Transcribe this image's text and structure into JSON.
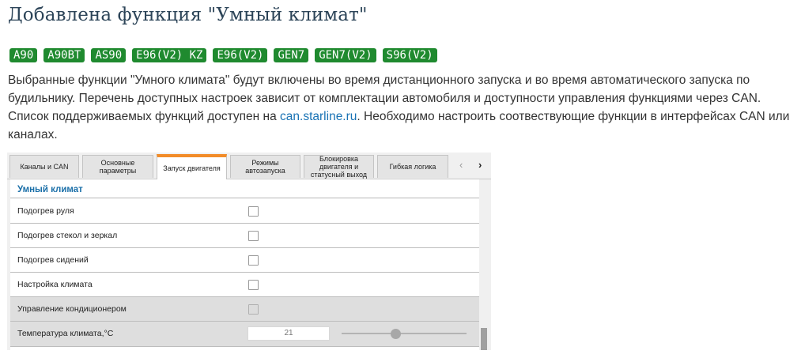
{
  "page": {
    "title": "Добавлена функция \"Умный климат\"",
    "badges": [
      "A90",
      "A90BT",
      "AS90",
      "E96(V2) KZ",
      "E96(V2)",
      "GEN7",
      "GEN7(V2)",
      "S96(V2)"
    ],
    "description": {
      "part1": "Выбранные функции \"Умного климата\" будут включены во время дистанционного запуска и во время автоматического запуска по будильнику. Перечень доступных настроек зависит от комплектации автомобиля и доступности управления функциями через CAN. Список поддерживаемых функций доступен на ",
      "link": "can.starline.ru",
      "part2": ". Необходимо настроить соотвествующие функции в интерфейсах CAN или каналах."
    }
  },
  "app": {
    "tabs": [
      {
        "label": "Каналы и CAN"
      },
      {
        "label": "Основные параметры"
      },
      {
        "label": "Запуск двигателя",
        "active": true
      },
      {
        "label": "Режимы автозапуска"
      },
      {
        "label": "Блокировка двигателя и статусный выход"
      },
      {
        "label": "Гибкая логика"
      }
    ],
    "nav": {
      "prev": "‹",
      "next": "›"
    },
    "section_title": "Умный климат",
    "rows": [
      {
        "label": "Подогрев руля",
        "checked": false
      },
      {
        "label": "Подогрев стекол и зеркал",
        "checked": false
      },
      {
        "label": "Подогрев сидений",
        "checked": false
      },
      {
        "label": "Настройка климата",
        "checked": false
      },
      {
        "label": "Управление кондиционером",
        "checked": false,
        "disabled": true
      }
    ],
    "temperature": {
      "label": "Температура климата,°C",
      "value": "21"
    },
    "colors": {
      "accent_tab": "#f28c28",
      "section_title": "#1a6fa8",
      "badge": "#1f8a2f",
      "link": "#1a73b5"
    }
  }
}
